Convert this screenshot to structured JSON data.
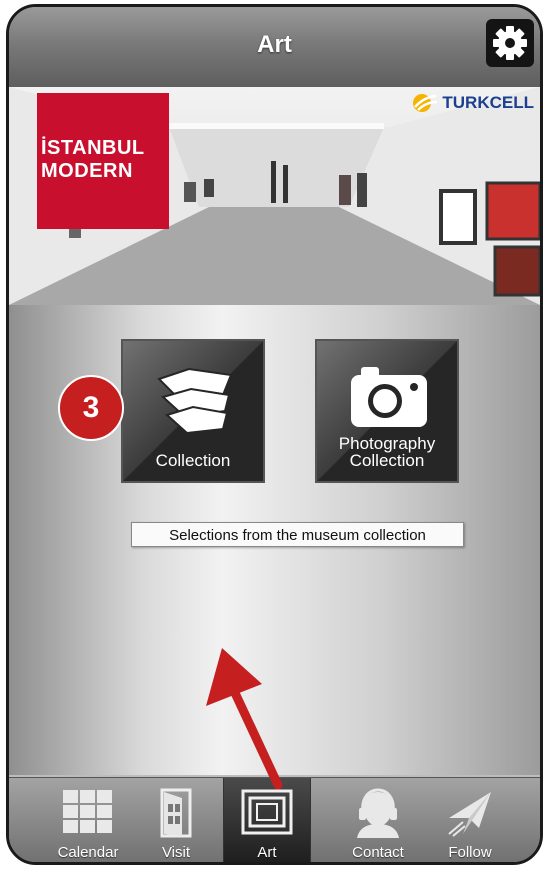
{
  "header": {
    "title": "Art",
    "settings_icon": "gear-icon"
  },
  "banner": {
    "logo_line1": "İSTANBUL",
    "logo_line2": "MODERN",
    "sponsor": "TURKCELL",
    "logo_color": "#c8102e",
    "sponsor_color": "#1d3f8f"
  },
  "tiles": [
    {
      "label": "Collection",
      "icon": "collection-icon"
    },
    {
      "label_line1": "Photography",
      "label_line2": "Collection",
      "icon": "camera-icon"
    }
  ],
  "badge": {
    "number": "3",
    "color": "#c51f1f"
  },
  "description": "Selections from the museum collection",
  "annotation": {
    "arrow_color": "#c51f1f"
  },
  "tabs": [
    {
      "label": "Calendar",
      "icon": "calendar-icon"
    },
    {
      "label": "Visit",
      "icon": "door-icon"
    },
    {
      "label": "Art",
      "icon": "frame-icon",
      "active": true
    },
    {
      "label": "Contact",
      "icon": "headset-icon"
    },
    {
      "label": "Follow",
      "icon": "paper-plane-icon"
    }
  ]
}
